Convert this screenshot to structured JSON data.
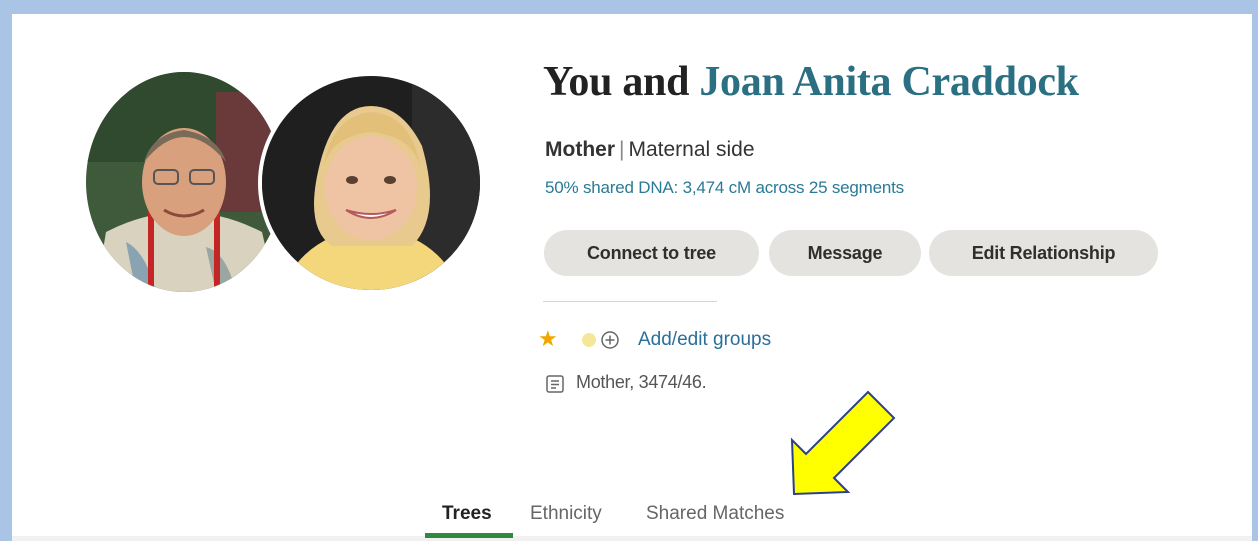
{
  "header": {
    "title_prefix": "You and",
    "match_name": "Joan Anita Craddock"
  },
  "relationship": {
    "label": "Mother",
    "separator": "|",
    "side": "Maternal side"
  },
  "dna": {
    "summary": "50% shared DNA: 3,474 cM across 25 segments"
  },
  "actions": {
    "connect_label": "Connect to tree",
    "message_label": "Message",
    "edit_label": "Edit Relationship"
  },
  "groups": {
    "star_icon": "star-icon",
    "link_label": "Add/edit groups",
    "colors": {
      "star": "#f2a700",
      "dot": "#f5e79a",
      "link": "#2a6f9a"
    }
  },
  "note": {
    "icon": "note-icon",
    "text": "Mother, 3474/46."
  },
  "tabs": [
    {
      "label": "Trees",
      "active": true
    },
    {
      "label": "Ethnicity",
      "active": false
    },
    {
      "label": "Shared Matches",
      "active": false
    }
  ],
  "colors": {
    "accent": "#2a6f82",
    "active_tab": "#2e8b3d",
    "button_bg": "#e4e3df",
    "frame": "#aac4e6",
    "arrow": "#ffff00"
  }
}
